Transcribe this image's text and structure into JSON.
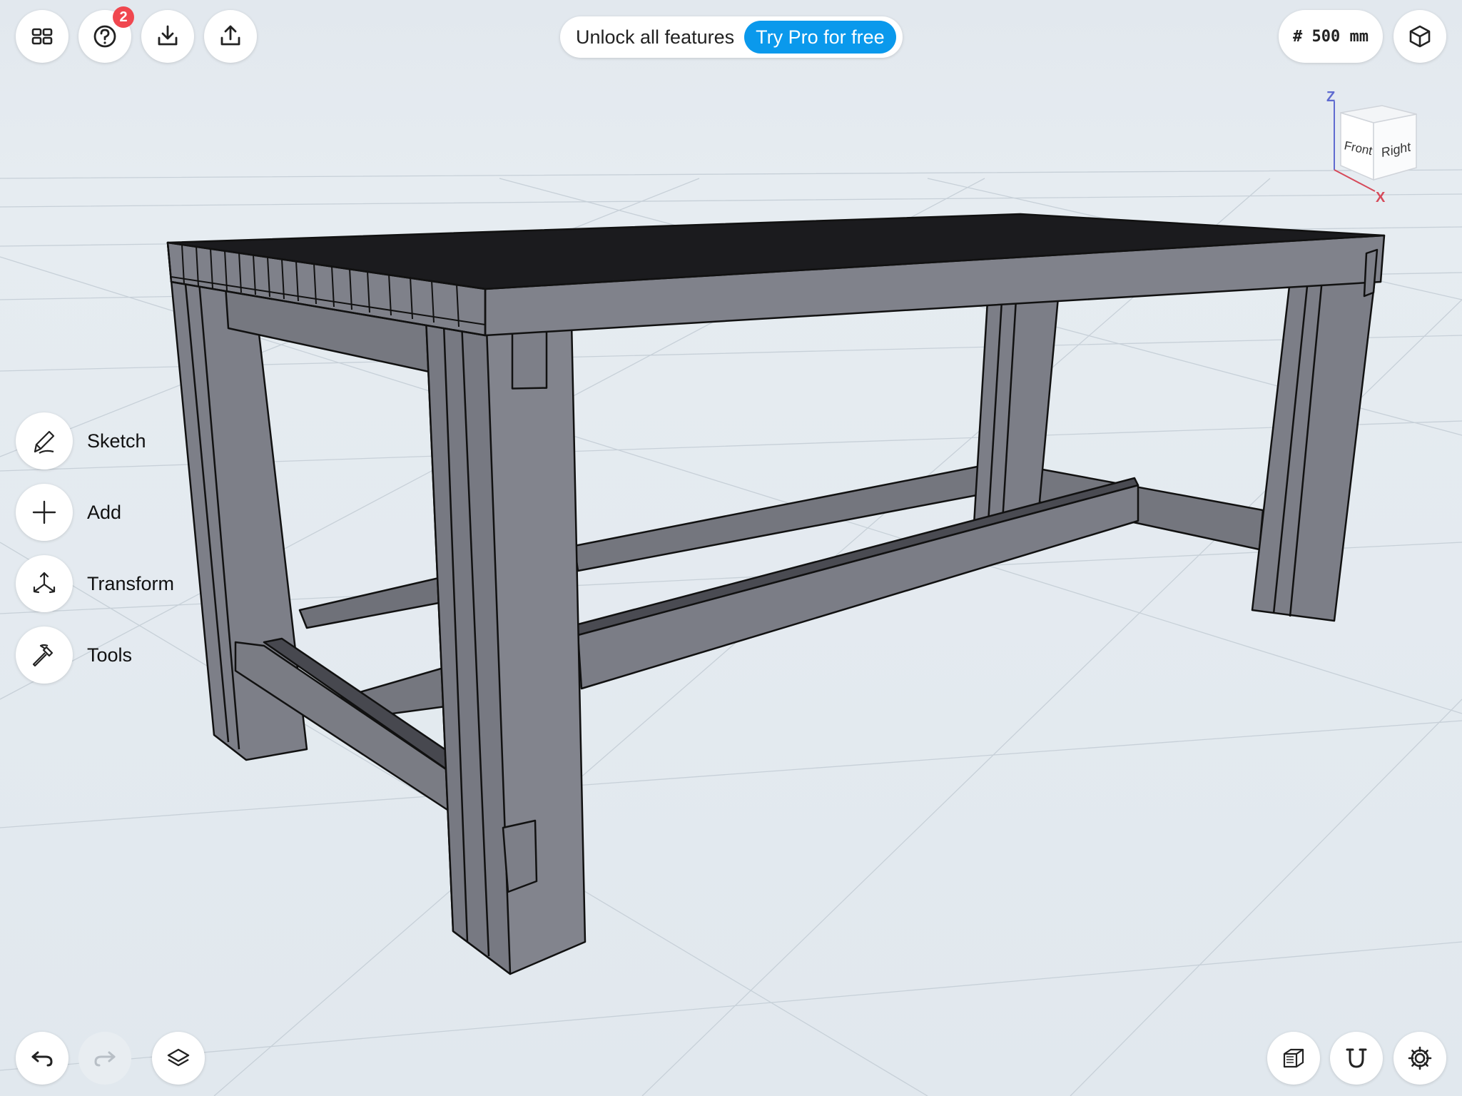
{
  "toolbar": {
    "help_badge": "2",
    "promo_text": "Unlock all features",
    "promo_cta": "Try Pro for free",
    "grid_size": "# 500 mm"
  },
  "tools": [
    {
      "label": "Sketch",
      "icon": "pencil-icon"
    },
    {
      "label": "Add",
      "icon": "plus-icon"
    },
    {
      "label": "Transform",
      "icon": "transform-arrows-icon"
    },
    {
      "label": "Tools",
      "icon": "hammer-icon"
    }
  ],
  "viewcube": {
    "axis_z": "Z",
    "axis_x": "X",
    "face_front": "Front",
    "face_right": "Right"
  },
  "colors": {
    "accent": "#0a99ec",
    "badge": "#f0474f",
    "model_face": "#7a7c85",
    "background": "#e4ebf0"
  }
}
